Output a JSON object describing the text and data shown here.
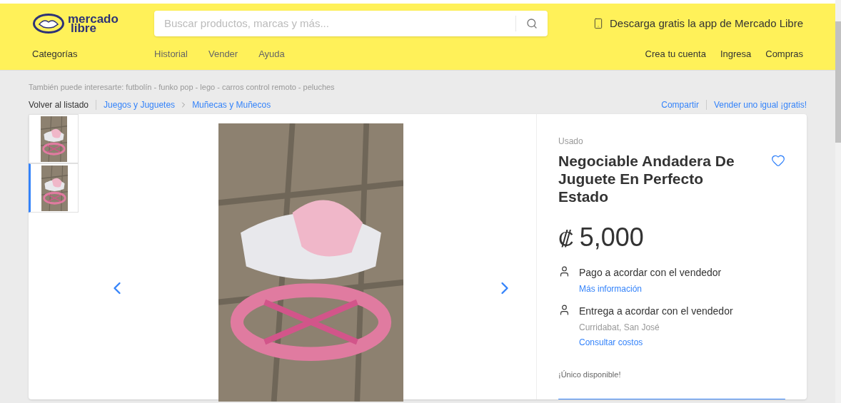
{
  "header": {
    "logo": [
      "mercado",
      "libre"
    ],
    "search": {
      "placeholder": "Buscar productos, marcas y más..."
    },
    "app_promo": "Descarga gratis la app de Mercado Libre",
    "categories": "Categorías",
    "nav": [
      "Historial",
      "Vender",
      "Ayuda"
    ],
    "account": [
      "Crea tu cuenta",
      "Ingresa",
      "Compras"
    ]
  },
  "suggestions": "También puede interesarte: futbolín - funko pop - lego - carros control remoto - peluches",
  "breadcrumb": {
    "back": "Volver al listado",
    "path": [
      "Juegos y Juguetes",
      "Muñecas y Muñecos"
    ],
    "actions": [
      "Compartir",
      "Vender uno igual ¡gratis!"
    ]
  },
  "gallery": {
    "thumbnails": [
      {
        "selected": false
      },
      {
        "selected": true
      }
    ]
  },
  "product": {
    "condition": "Usado",
    "title": "Negociable Andadera De Juguete En Perfecto Estado",
    "favorite": false,
    "currency": "₡",
    "price": "5,000",
    "info": [
      {
        "text": "Pago a acordar con el vendedor",
        "lines": [
          {
            "kind": "link",
            "text": "Más información"
          }
        ]
      },
      {
        "text": "Entrega a acordar con el vendedor",
        "lines": [
          {
            "kind": "note",
            "text": "Curridabat, San José"
          },
          {
            "kind": "link",
            "text": "Consultar costos"
          }
        ]
      }
    ],
    "stock": "¡Único disponible!"
  }
}
